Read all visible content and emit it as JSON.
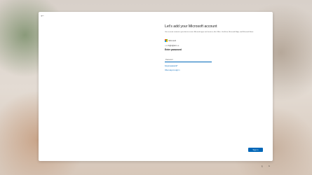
{
  "window": {
    "title": "Let's add your Microsoft account",
    "description": "Use account content to your device across Microsoft apps and services, like Office, OneDrive, Microsoft Edge, and Microsoft Store."
  },
  "account": {
    "provider_label": "Microsoft",
    "email": "‹  •• i•S@4@lwm  •••",
    "back_glyph": "←"
  },
  "password": {
    "heading": "Enter password",
    "placeholder": "Password",
    "value": ""
  },
  "links": {
    "forgot": "Forgot password?",
    "other_signin": "Other ways to sign in"
  },
  "actions": {
    "back": "←",
    "next": "Sign in"
  },
  "tray": {
    "accessibility": "♁",
    "network": "◔"
  },
  "colors": {
    "accent": "#0067b8",
    "ms_red": "#f25022",
    "ms_green": "#7fba00",
    "ms_blue": "#00a4ef",
    "ms_yellow": "#ffb900"
  }
}
